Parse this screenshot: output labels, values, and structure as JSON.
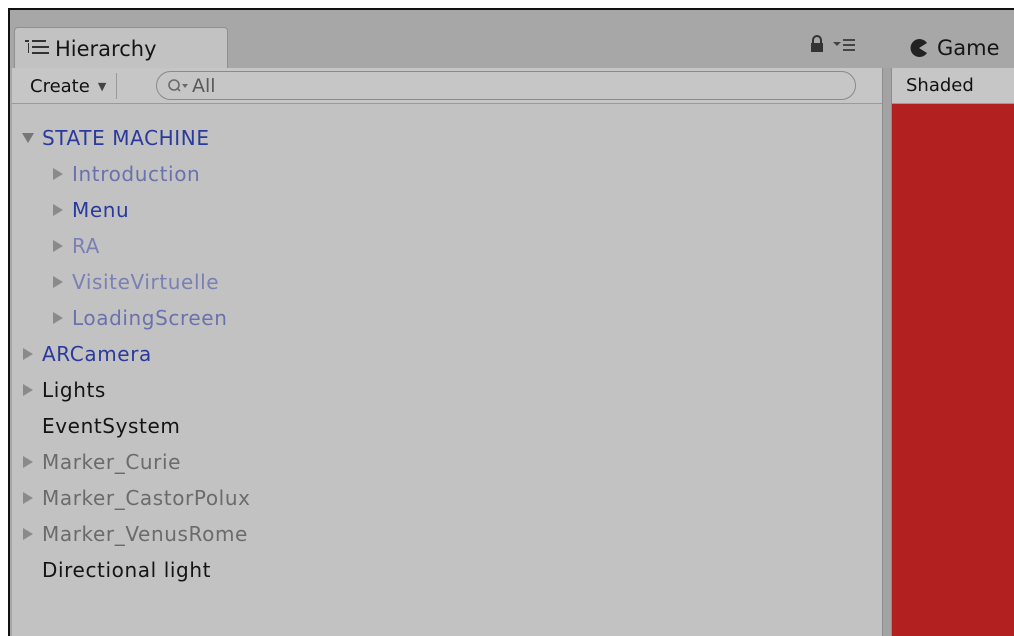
{
  "hierarchy_panel": {
    "tab_title": "Hierarchy",
    "create_label": "Create",
    "search_placeholder": "All",
    "items": [
      {
        "label": "STATE MACHINE",
        "level": 0,
        "expandable": true,
        "expanded": true,
        "color": "#2a3a9c"
      },
      {
        "label": "Introduction",
        "level": 1,
        "expandable": true,
        "expanded": false,
        "color": "#6a72ad"
      },
      {
        "label": "Menu",
        "level": 1,
        "expandable": true,
        "expanded": false,
        "color": "#2a3a9c"
      },
      {
        "label": "RA",
        "level": 1,
        "expandable": true,
        "expanded": false,
        "color": "#7a80b3"
      },
      {
        "label": "VisiteVirtuelle",
        "level": 1,
        "expandable": true,
        "expanded": false,
        "color": "#7a80b3"
      },
      {
        "label": "LoadingScreen",
        "level": 1,
        "expandable": true,
        "expanded": false,
        "color": "#6a72ad"
      },
      {
        "label": "ARCamera",
        "level": 0,
        "expandable": true,
        "expanded": false,
        "color": "#2a3a9c"
      },
      {
        "label": "Lights",
        "level": 0,
        "expandable": true,
        "expanded": false,
        "color": "#141414"
      },
      {
        "label": "EventSystem",
        "level": 0,
        "expandable": false,
        "expanded": false,
        "color": "#141414"
      },
      {
        "label": "Marker_Curie",
        "level": 0,
        "expandable": true,
        "expanded": false,
        "color": "#6b6b6b"
      },
      {
        "label": "Marker_CastorPolux",
        "level": 0,
        "expandable": true,
        "expanded": false,
        "color": "#6b6b6b"
      },
      {
        "label": "Marker_VenusRome",
        "level": 0,
        "expandable": true,
        "expanded": false,
        "color": "#6b6b6b"
      },
      {
        "label": "Directional light",
        "level": 0,
        "expandable": false,
        "expanded": false,
        "color": "#141414"
      }
    ]
  },
  "game_panel": {
    "tab_title": "Game",
    "shading_label": "Shaded",
    "view_color": "#b22020"
  },
  "icons": {
    "hierarchy_tab": "hierarchy-list-icon",
    "lock": "lock-icon",
    "menu": "panel-menu-icon",
    "search": "search-icon",
    "game_tab": "pacman-game-icon",
    "expand": "triangle-right-icon",
    "collapse": "triangle-down-icon"
  }
}
